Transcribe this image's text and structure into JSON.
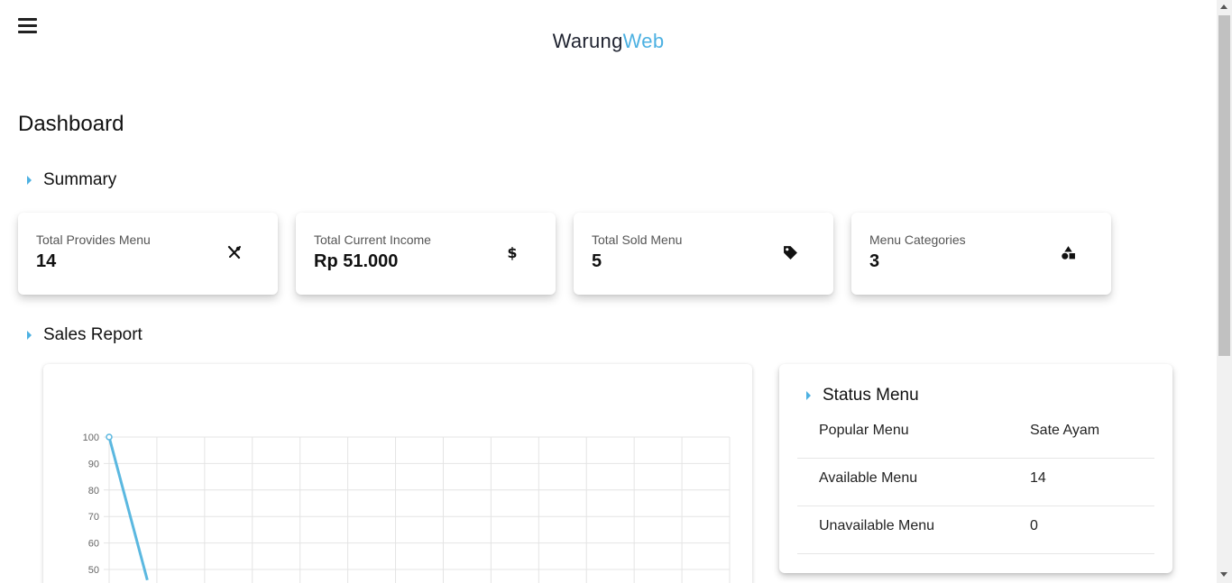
{
  "header": {
    "brand_part1": "Warung",
    "brand_part2": "Web",
    "brand_color_primary": "#1f2330",
    "brand_color_accent": "#4db1e2",
    "menu_icon": "hamburger-icon"
  },
  "page": {
    "title": "Dashboard"
  },
  "sections": {
    "summary": "Summary",
    "sales_report": "Sales Report"
  },
  "summary_cards": [
    {
      "label": "Total Provides Menu",
      "value": "14",
      "icon": "utensils-icon"
    },
    {
      "label": "Total Current Income",
      "value": "Rp 51.000",
      "icon": "dollar-icon"
    },
    {
      "label": "Total Sold Menu",
      "value": "5",
      "icon": "tag-icon"
    },
    {
      "label": "Menu Categories",
      "value": "3",
      "icon": "shapes-icon"
    }
  ],
  "status_menu": {
    "title": "Status Menu",
    "rows": [
      {
        "label": "Popular Menu",
        "value": "Sate Ayam"
      },
      {
        "label": "Available Menu",
        "value": "14"
      },
      {
        "label": "Unavailable Menu",
        "value": "0"
      }
    ]
  },
  "chart_data": {
    "type": "line",
    "title": "",
    "xlabel": "",
    "ylabel": "",
    "yticks": [
      50,
      60,
      70,
      80,
      90,
      100
    ],
    "ylim_visible": [
      50,
      100
    ],
    "grid": true,
    "line_color": "#5bb8e0",
    "series": [
      {
        "points": [
          {
            "x": 0,
            "y": 100
          },
          {
            "x": 0.8,
            "y": 46
          }
        ]
      }
    ]
  }
}
